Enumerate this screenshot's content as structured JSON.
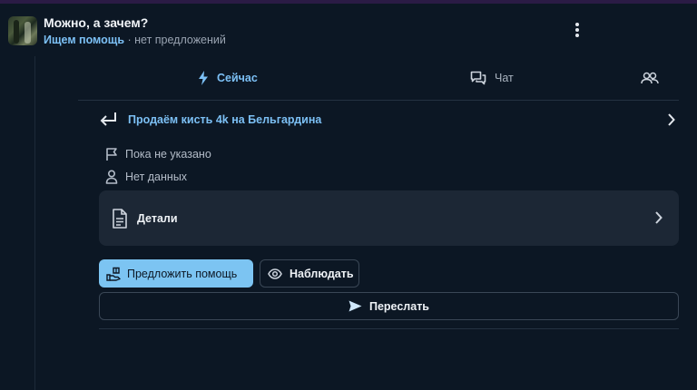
{
  "header": {
    "title": "Можно, а зачем?",
    "status": "Ищем помощь",
    "separator": " · ",
    "offers": "нет предложений"
  },
  "tabs": [
    {
      "label": "Сейчас",
      "icon": "lightning-icon",
      "active": true
    },
    {
      "label": "Чат",
      "icon": "chat-icon",
      "active": false
    },
    {
      "label": "",
      "icon": "people-icon",
      "active": false
    }
  ],
  "linked_item": {
    "label": "Продаём кисть 4k на Бельгардина",
    "icon": "return-arrow-icon"
  },
  "meta": {
    "location": "Пока не указано",
    "person": "Нет данных"
  },
  "details": {
    "label": "Детали"
  },
  "actions": {
    "offer_help": "Предложить помощь",
    "watch": "Наблюдать",
    "forward": "Переслать"
  },
  "colors": {
    "background": "#0c1724",
    "accent": "#7cc0f5",
    "card": "#1c2735",
    "top_strip": "#2b1b45"
  }
}
